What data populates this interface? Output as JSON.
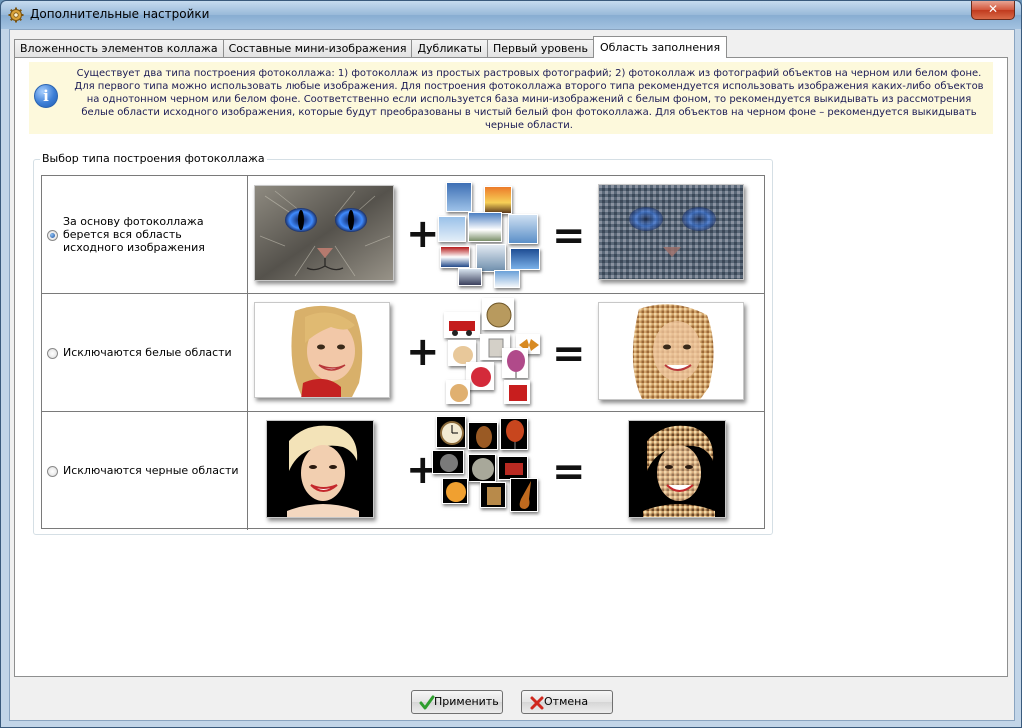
{
  "window": {
    "title": "Дополнительные настройки",
    "close_label": "✕"
  },
  "tabs": [
    {
      "label": "Вложенность элементов коллажа",
      "active": false
    },
    {
      "label": "Составные мини-изображения",
      "active": false
    },
    {
      "label": "Дубликаты",
      "active": false
    },
    {
      "label": "Первый уровень",
      "active": false
    },
    {
      "label": "Область заполнения",
      "active": true
    }
  ],
  "info": {
    "icon": "info-icon",
    "text": "Существует два типа построения фотоколлажа: 1) фотоколлаж из простых растровых фотографий; 2) фотоколлаж из фотографий объектов на черном или белом фоне. Для первого типа можно использовать любые изображения. Для построения фотоколлажа второго типа рекомендуется использовать изображения каких-либо объектов на однотонном черном или белом фоне. Соответственно если используется база мини-изображений с белым фоном, то рекомендуется выкидывать из рассмотрения белые области исходного изображения, которые будут преобразованы в чистый белый фон фотоколлажа. Для объектов на черном фоне – рекомендуется выкидывать черные области."
  },
  "group": {
    "label": "Выбор типа построения фотоколлажа",
    "options": [
      {
        "label": "За основу фотоколлажа берется вся область исходного изображения",
        "checked": true
      },
      {
        "label": "Исключаются белые области",
        "checked": false
      },
      {
        "label": "Исключаются черные области",
        "checked": false
      }
    ],
    "plus": "+",
    "equals": "="
  },
  "buttons": {
    "apply": "Применить",
    "cancel": "Отмена"
  },
  "colors": {
    "accent": "#3d7fd6",
    "info_bg": "#fdf9dc",
    "apply_icon": "#2e9e2e",
    "cancel_icon": "#d0281e"
  }
}
